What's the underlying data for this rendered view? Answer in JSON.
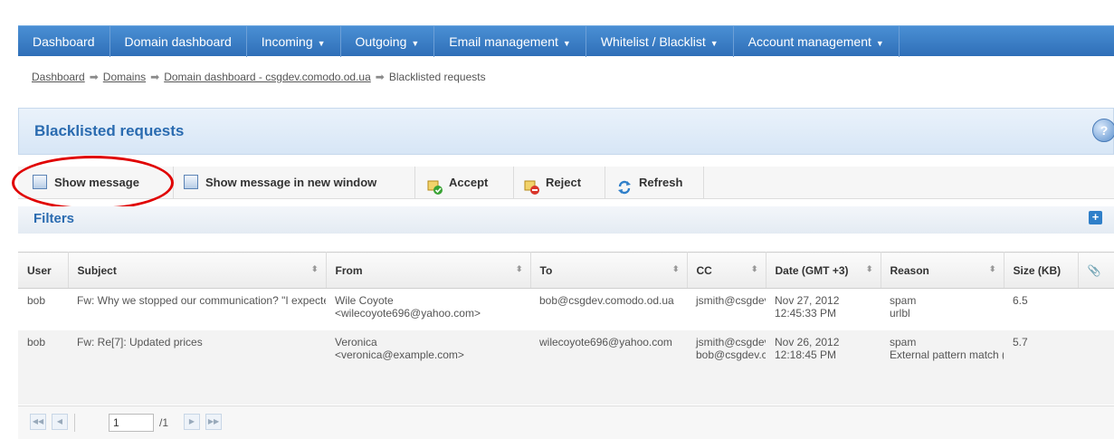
{
  "nav": {
    "items": [
      {
        "label": "Dashboard",
        "dropdown": false
      },
      {
        "label": "Domain dashboard",
        "dropdown": false
      },
      {
        "label": "Incoming",
        "dropdown": true
      },
      {
        "label": "Outgoing",
        "dropdown": true
      },
      {
        "label": "Email management",
        "dropdown": true
      },
      {
        "label": "Whitelist / Blacklist",
        "dropdown": true
      },
      {
        "label": "Account management",
        "dropdown": true
      }
    ]
  },
  "breadcrumb": {
    "items": [
      "Dashboard",
      "Domains",
      "Domain dashboard - csgdev.comodo.od.ua"
    ],
    "current": "Blacklisted requests"
  },
  "panel": {
    "title": "Blacklisted requests"
  },
  "toolbar": {
    "show_message": "Show message",
    "show_message_new_window": "Show message in new window",
    "accept": "Accept",
    "reject": "Reject",
    "refresh": "Refresh"
  },
  "filters": {
    "title": "Filters"
  },
  "table": {
    "columns": [
      "User",
      "Subject",
      "From",
      "To",
      "CC",
      "Date (GMT +3)",
      "Reason",
      "Size (KB)"
    ],
    "rows": [
      {
        "user": "bob",
        "subject": "Fw: Why we stopped our communication? \"I expected more, Olga!",
        "from_name": "Wile Coyote",
        "from_email": "<wilecoyote696@yahoo.com>",
        "to": "bob@csgdev.comodo.od.ua",
        "cc1": "jsmith@csgdev.comodo.od.ua",
        "cc2": "",
        "date": "Nov 27, 2012",
        "time": "12:45:33 PM",
        "reason": [
          "spam",
          "urlbl"
        ],
        "size": "6.5"
      },
      {
        "user": "bob",
        "subject": "Fw: Re[7]: Updated prices",
        "from_name": "Veronica",
        "from_email": "<veronica@example.com>",
        "to": "wilecoyote696@yahoo.com",
        "cc1": "jsmith@csgdev.comodo.od.ua",
        "cc2": "bob@csgdev.comodo.od.ua",
        "date": "Nov 26, 2012",
        "time": "12:18:45 PM",
        "reason": [
          "spam",
          "External pattern match (Sanesecurity.Junk."
        ],
        "size": "5.7"
      }
    ]
  },
  "pager": {
    "page": "1",
    "of": "/1"
  },
  "colors": {
    "nav_bg": "#3a7fc8",
    "title": "#2a6bb0",
    "highlight": "#e00000"
  },
  "icons": {
    "help": "help-icon",
    "expand": "expand-icon",
    "attachment": "paperclip-icon"
  }
}
